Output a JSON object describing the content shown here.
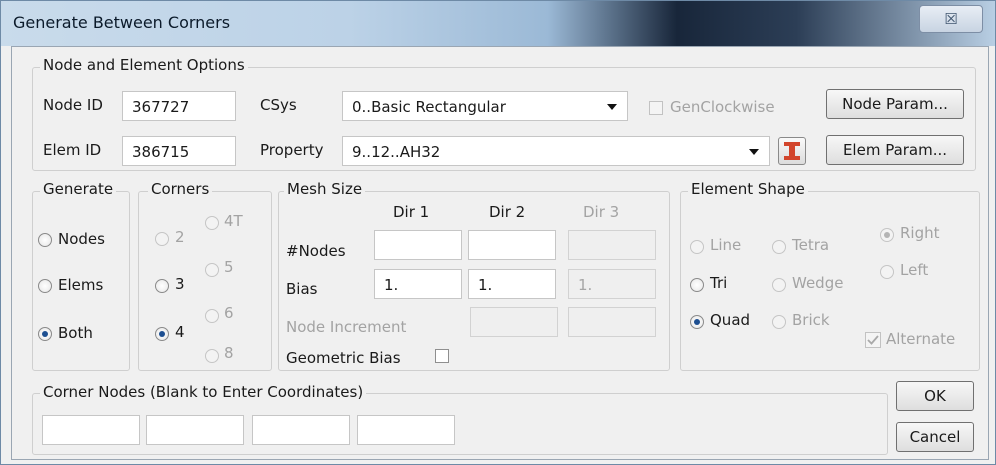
{
  "window": {
    "title": "Generate Between Corners",
    "close_glyph": "☒"
  },
  "node_elem": {
    "group_label": "Node and Element Options",
    "node_id_label": "Node ID",
    "node_id_value": "367727",
    "elem_id_label": "Elem ID",
    "elem_id_value": "386715",
    "csys_label": "CSys",
    "csys_value": "0..Basic Rectangular",
    "property_label": "Property",
    "property_value": "9..12..AH32",
    "genclockwise_label": "GenClockwise",
    "node_param_label": "Node Param...",
    "elem_param_label": "Elem Param...",
    "property_icon": "ibeam-icon"
  },
  "generate": {
    "group_label": "Generate",
    "options": [
      "Nodes",
      "Elems",
      "Both"
    ],
    "selected": "Both"
  },
  "corners": {
    "group_label": "Corners",
    "options": [
      "2",
      "4T",
      "5",
      "3",
      "6",
      "4",
      "8"
    ],
    "selected": "4"
  },
  "mesh": {
    "group_label": "Mesh Size",
    "dir_headers": [
      "Dir 1",
      "Dir 2",
      "Dir 3"
    ],
    "nodes_label": "#Nodes",
    "nodes_values": [
      "",
      "",
      ""
    ],
    "bias_label": "Bias",
    "bias_values": [
      "1.",
      "1.",
      "1."
    ],
    "node_increment_label": "Node Increment",
    "node_increment_values": [
      "",
      ""
    ],
    "geometric_bias_label": "Geometric Bias"
  },
  "element_shape": {
    "group_label": "Element Shape",
    "options": [
      "Line",
      "Tetra",
      "Right",
      "Left",
      "Tri",
      "Wedge",
      "Quad",
      "Brick"
    ],
    "selected": "Quad",
    "orientation_selected": "Right",
    "alternate_label": "Alternate",
    "alternate_checked": true
  },
  "corner_nodes": {
    "group_label": "Corner Nodes (Blank to Enter Coordinates)",
    "values": [
      "",
      "",
      "",
      ""
    ]
  },
  "buttons": {
    "ok": "OK",
    "cancel": "Cancel"
  },
  "colors": {
    "accent": "#1d4f91",
    "titlebar": "#bcd2e7",
    "ibeam": "#d2452c"
  }
}
